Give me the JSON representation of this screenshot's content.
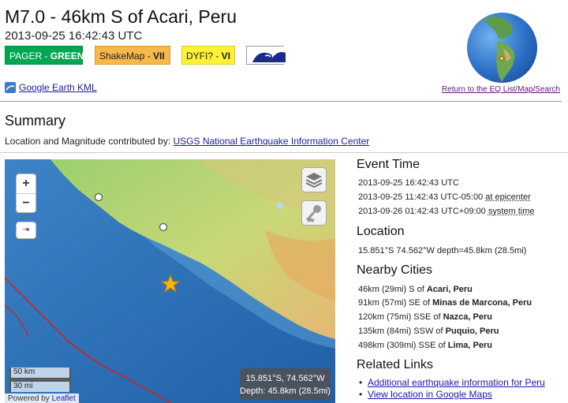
{
  "event": {
    "title": "M7.0 - 46km S of Acari, Peru",
    "datetime": "2013-09-25 16:42:43 UTC"
  },
  "badges": {
    "pager_label": "PAGER - ",
    "pager_level": "GREEN",
    "shakemap_label": "ShakeMap - ",
    "shakemap_level": "VII",
    "dyfi_label": "DYFI? - ",
    "dyfi_level": "VI",
    "tsunami_icon": "tsunami-wave-icon"
  },
  "links": {
    "kml": "Google Earth KML",
    "return": "Return to the EQ List/Map/Search"
  },
  "summary": {
    "heading": "Summary",
    "contrib_prefix": "Location and Magnitude contributed by: ",
    "contrib_link": "USGS National Earthquake Information Center"
  },
  "map": {
    "zoom_in": "+",
    "zoom_out": "−",
    "fullscreen": "⇥",
    "scale_km": "50 km",
    "scale_mi": "30 mi",
    "attribution_prefix": "Powered by ",
    "attribution_link": "Leaflet",
    "coords_line": "15.851°S, 74.562°W",
    "depth_line": "Depth: 45.8km (28.5mi)",
    "colors": {
      "ocean": "#2b6fb5",
      "land_low": "#8fc96a",
      "land_high": "#e8c078",
      "epicenter": "#ffb400"
    }
  },
  "event_time": {
    "heading": "Event Time",
    "utc": "2013-09-25 16:42:43 UTC",
    "epicenter_time": "2013-09-25 11:42:43 UTC-05:00 ",
    "epicenter_label": "at epicenter",
    "system_time": "2013-09-26 01:42:43 UTC+09:00 ",
    "system_label": "system time"
  },
  "location": {
    "heading": "Location",
    "text": "15.851°S 74.562°W depth=45.8km (28.5mi)"
  },
  "nearby": {
    "heading": "Nearby Cities",
    "cities": [
      {
        "dist": "46km (29mi) S of ",
        "name": "Acari, Peru"
      },
      {
        "dist": "91km (57mi) SE of ",
        "name": "Minas de Marcona, Peru"
      },
      {
        "dist": "120km (75mi) SSE of ",
        "name": "Nazca, Peru"
      },
      {
        "dist": "135km (84mi) SSW of ",
        "name": "Puquio, Peru"
      },
      {
        "dist": "498km (309mi) SSE of ",
        "name": "Lima, Peru"
      }
    ]
  },
  "related": {
    "heading": "Related Links",
    "items": [
      "Additional earthquake information for Peru",
      "View location in Google Maps"
    ]
  }
}
